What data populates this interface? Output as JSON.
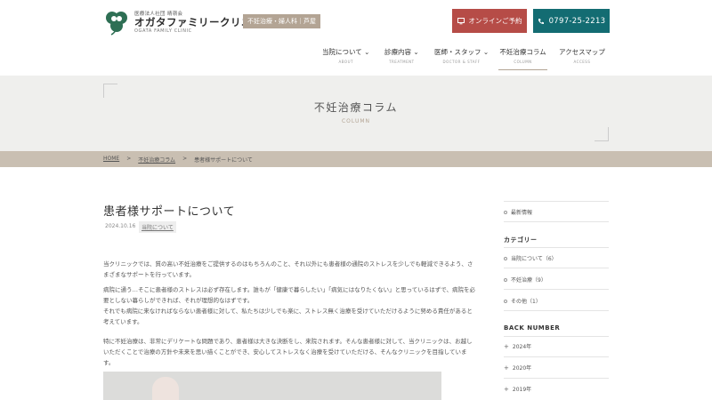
{
  "header": {
    "logo_small": "医療法人社団 晴嶺会",
    "logo_main": "オガタファミリークリニック",
    "logo_badge": "不妊治療・婦人科｜芦屋",
    "logo_en": "OGATA FAMILY CLINIC",
    "online_label": "オンラインご予約",
    "phone_label": "0797-25-2213"
  },
  "nav": [
    {
      "jp": "当院について",
      "en": "ABOUT"
    },
    {
      "jp": "診療内容",
      "en": "TREATMENT"
    },
    {
      "jp": "医師・スタッフ",
      "en": "DOCTOR & STAFF"
    },
    {
      "jp": "不妊治療コラム",
      "en": "COLUMN"
    },
    {
      "jp": "アクセスマップ",
      "en": "ACCESS"
    }
  ],
  "banner": {
    "title": "不妊治療コラム",
    "subtitle": "COLUMN"
  },
  "breadcrumb": [
    "HOME",
    "不妊治療コラム",
    "患者様サポートについて"
  ],
  "post": {
    "title": "患者様サポートについて",
    "date": "2024.10.16",
    "category": "当院について",
    "p1": "当クリニックでは、質の高い不妊治療をご提供するのはもちろんのこと、それ以外にも患者様の通院のストレスを少しでも軽減できるよう、さまざまなサポートを行っています。",
    "p2": "病院に通う…そこに患者様のストレスは必ず存在します。誰もが「健康で暮らしたい」「病気にはなりたくない」と思っているはずで、病院を必要としない暮らしができれば、それが理想的なはずです。",
    "p3": "それでも病院に来なければならない患者様に対して、私たちは少しでも楽に、ストレス無く治療を受けていただけるように努める責任があると考えています。",
    "p4": "特に不妊治療は、非常にデリケートな問題であり、患者様は大きな決断をし、来院されます。そんな患者様に対して、当クリニックは、お越しいただくことで治療の方針や未来を思い描くことができ、安心してストレスなく治療を受けていただける、そんなクリニックを目指しています。"
  },
  "sidebar": {
    "latest": "最新情報",
    "category_head": "カテゴリー",
    "categories": [
      "当院について（6）",
      "不妊治療（9）",
      "その他（1）"
    ],
    "backnumber_head": "BACK NUMBER",
    "years": [
      "2024年",
      "2020年",
      "2019年"
    ]
  },
  "colors": {
    "online": "#b64c47",
    "phone": "#136c72",
    "accent": "#b3a494"
  },
  "icons": {
    "online": "monitor-icon",
    "phone": "phone-icon"
  }
}
